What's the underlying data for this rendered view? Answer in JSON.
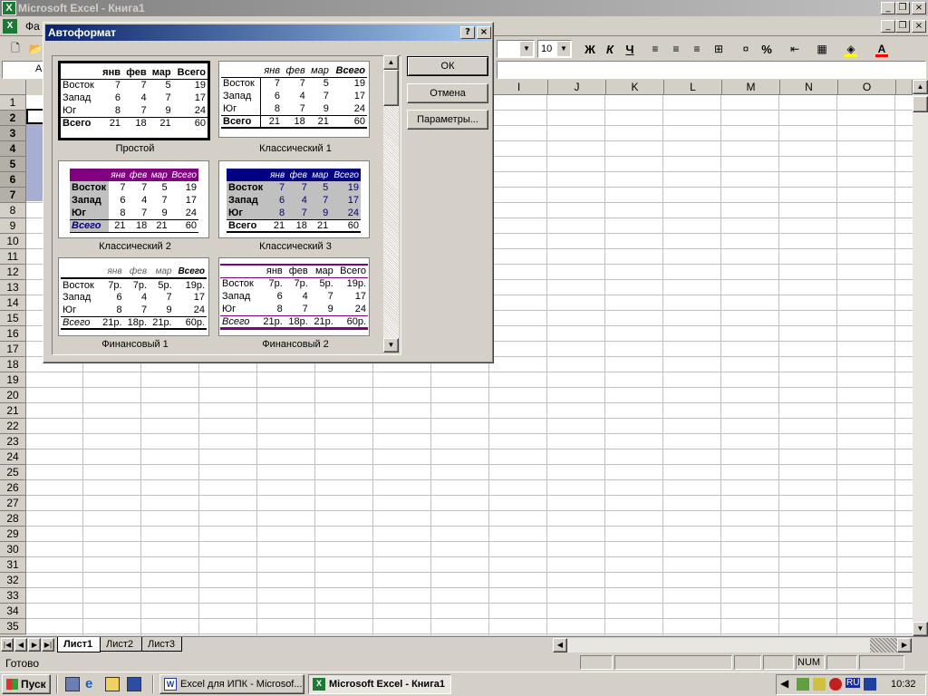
{
  "app": {
    "title": "Microsoft Excel - Книга1",
    "menu_file": "Фа"
  },
  "toolbar": {
    "font_size": "10",
    "bold": "Ж",
    "italic": "К",
    "underline": "Ч",
    "percent": "%",
    "name_box": "А"
  },
  "columns": [
    "I",
    "J",
    "K",
    "L",
    "M",
    "N",
    "O"
  ],
  "rows": [
    "1",
    "2",
    "3",
    "4",
    "5",
    "6",
    "7",
    "8",
    "9",
    "10",
    "11",
    "12",
    "13",
    "14",
    "15",
    "16",
    "17",
    "18",
    "19",
    "20",
    "21",
    "22",
    "23",
    "24",
    "25",
    "26",
    "27",
    "28",
    "29",
    "30",
    "31",
    "32",
    "33",
    "34",
    "35"
  ],
  "dialog": {
    "title": "Автоформат",
    "help": "?",
    "close": "×",
    "ok": "ОК",
    "cancel": "Отмена",
    "options": "Параметры...",
    "formats": [
      {
        "name": "Простой",
        "header": [
          "",
          "янв",
          "фев",
          "мар",
          "Всего"
        ],
        "rows": [
          [
            "Восток",
            "7",
            "7",
            "5",
            "19"
          ],
          [
            "Запад",
            "6",
            "4",
            "7",
            "17"
          ],
          [
            "Юг",
            "8",
            "7",
            "9",
            "24"
          ],
          [
            "Всего",
            "21",
            "18",
            "21",
            "60"
          ]
        ]
      },
      {
        "name": "Классический 1",
        "header": [
          "",
          "янв",
          "фев",
          "мар",
          "Всего"
        ],
        "rows": [
          [
            "Восток",
            "7",
            "7",
            "5",
            "19"
          ],
          [
            "Запад",
            "6",
            "4",
            "7",
            "17"
          ],
          [
            "Юг",
            "8",
            "7",
            "9",
            "24"
          ],
          [
            "Всего",
            "21",
            "18",
            "21",
            "60"
          ]
        ]
      },
      {
        "name": "Классический 2",
        "header": [
          "",
          "янв",
          "фев",
          "мар",
          "Всего"
        ],
        "rows": [
          [
            "Восток",
            "7",
            "7",
            "5",
            "19"
          ],
          [
            "Запад",
            "6",
            "4",
            "7",
            "17"
          ],
          [
            "Юг",
            "8",
            "7",
            "9",
            "24"
          ],
          [
            "Всего",
            "21",
            "18",
            "21",
            "60"
          ]
        ]
      },
      {
        "name": "Классический 3",
        "header": [
          "",
          "янв",
          "фев",
          "мар",
          "Всего"
        ],
        "rows": [
          [
            "Восток",
            "7",
            "7",
            "5",
            "19"
          ],
          [
            "Запад",
            "6",
            "4",
            "7",
            "17"
          ],
          [
            "Юг",
            "8",
            "7",
            "9",
            "24"
          ],
          [
            "Всего",
            "21",
            "18",
            "21",
            "60"
          ]
        ]
      },
      {
        "name": "Финансовый 1",
        "header": [
          "",
          "янв",
          "фев",
          "мар",
          "Всего"
        ],
        "rows": [
          [
            "Восток",
            "7р.",
            "7р.",
            "5р.",
            "19р."
          ],
          [
            "Запад",
            "6",
            "4",
            "7",
            "17"
          ],
          [
            "Юг",
            "8",
            "7",
            "9",
            "24"
          ],
          [
            "Всего",
            "21р.",
            "18р.",
            "21р.",
            "60р."
          ]
        ]
      },
      {
        "name": "Финансовый 2",
        "header": [
          "",
          "янв",
          "фев",
          "мар",
          "Всего"
        ],
        "rows": [
          [
            "Восток",
            "7р.",
            "7р.",
            "5р.",
            "19р."
          ],
          [
            "Запад",
            "6",
            "4",
            "7",
            "17"
          ],
          [
            "Юг",
            "8",
            "7",
            "9",
            "24"
          ],
          [
            "Всего",
            "21р.",
            "18р.",
            "21р.",
            "60р."
          ]
        ]
      }
    ]
  },
  "sheets": [
    "Лист1",
    "Лист2",
    "Лист3"
  ],
  "status": {
    "ready": "Готово",
    "num": "NUM"
  },
  "taskbar": {
    "start": "Пуск",
    "task1": "Excel для ИПК - Microsof...",
    "task2": "Microsoft Excel - Книга1",
    "lang": "RU",
    "clock": "10:32"
  },
  "colors": {
    "titlebar_active": "#0a246a",
    "titlebar_inactive": "#808080",
    "classic2_header": "#800080",
    "classic3_header": "#000080"
  }
}
